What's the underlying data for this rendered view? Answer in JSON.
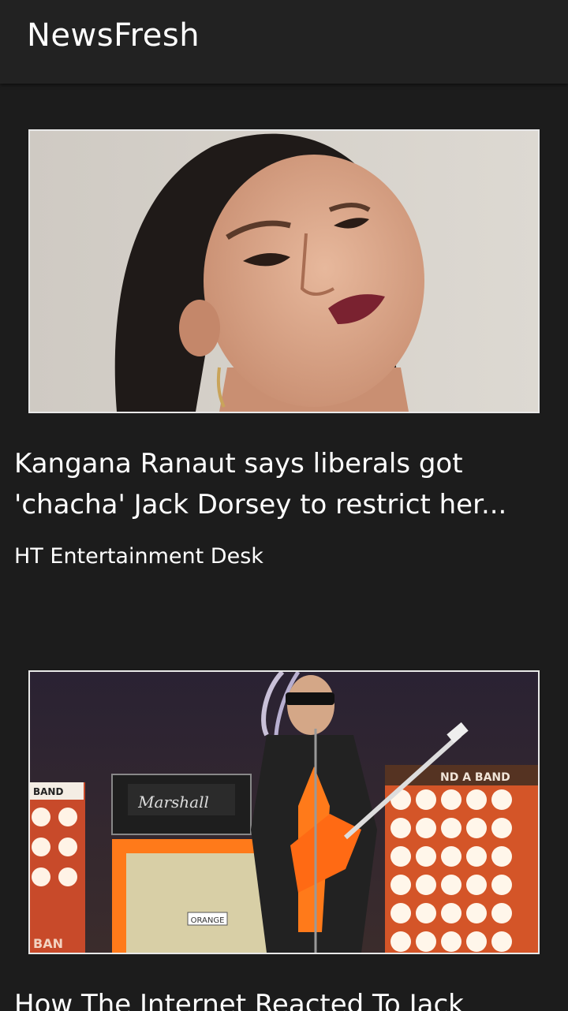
{
  "app": {
    "title": "NewsFresh"
  },
  "articles": [
    {
      "title_line1": "Kangana Ranaut says liberals got",
      "title_line2": "'chacha' Jack Dorsey to restrict her...",
      "source": "HT Entertainment Desk",
      "image": "portrait-photo"
    },
    {
      "title_line1": "How The Internet Reacted To Jack",
      "image": "concert-photo",
      "image_text": {
        "amp_brand": "Marshall",
        "amp_badge": "ORANGE",
        "sign_left": "BAND",
        "sign_right": "ND A BAND",
        "sign_bottom": "BAN"
      }
    }
  ],
  "colors": {
    "background": "#1c1c1c",
    "app_bar": "#222222",
    "text": "#ffffff",
    "accent_orange": "#ff7a1a"
  }
}
